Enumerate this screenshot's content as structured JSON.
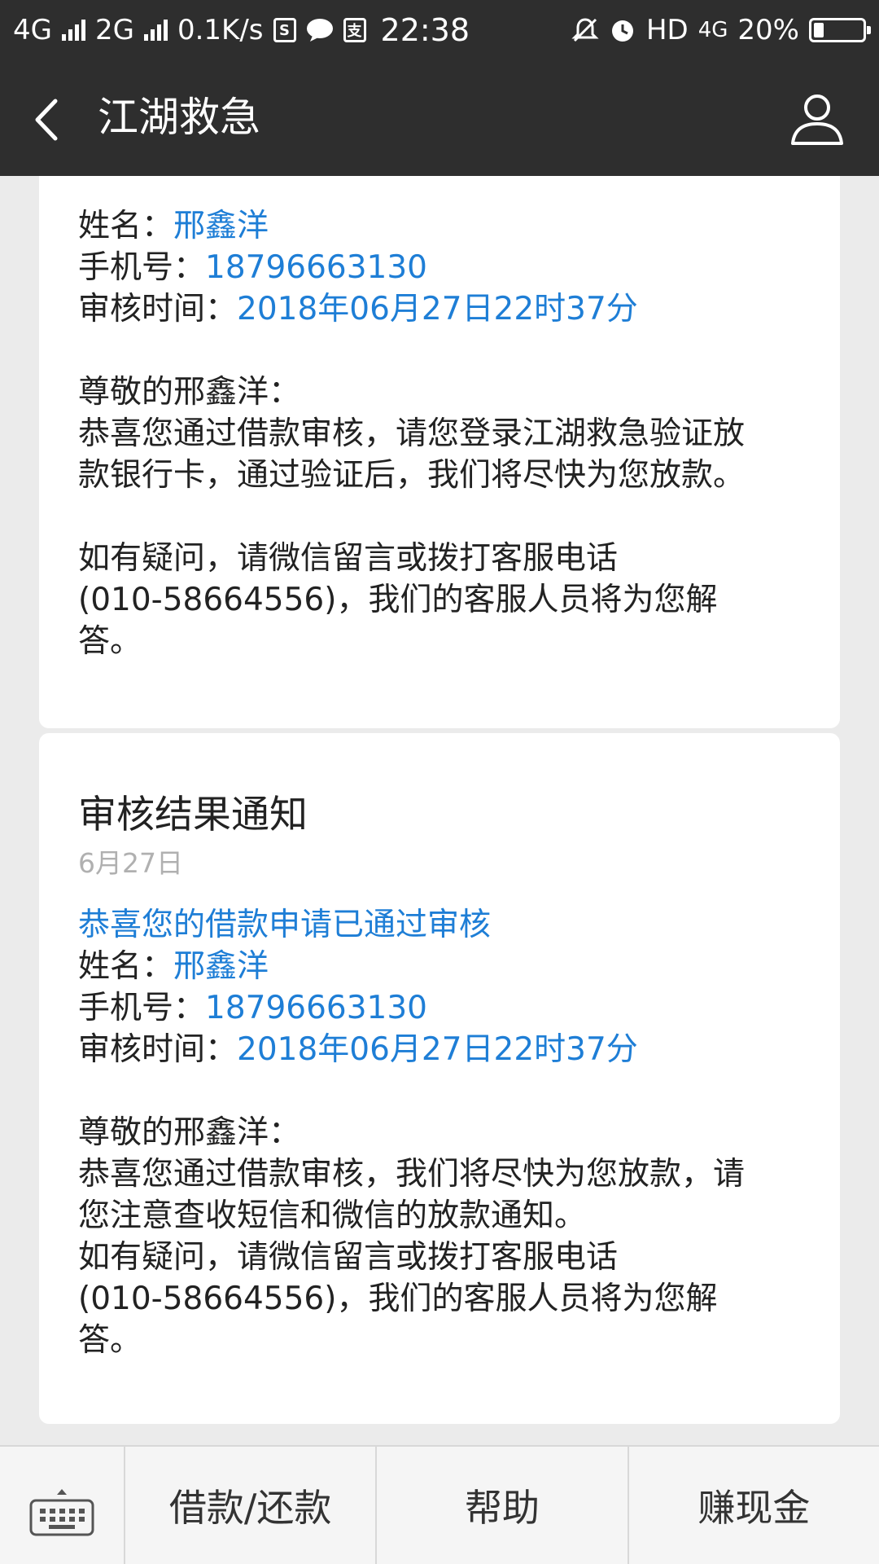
{
  "status_bar": {
    "net1": "4G",
    "net2": "2G",
    "speed": "0.1K/s",
    "time": "22:38",
    "hd": "HD",
    "net3": "4G",
    "battery": "20%",
    "battery_level": 0.2
  },
  "header": {
    "title": "江湖救急"
  },
  "card1": {
    "name_label": "姓名：",
    "name_value": "邢鑫洋",
    "phone_label": "手机号：",
    "phone_value": "18796663130",
    "time_label": "审核时间：",
    "time_value": "2018年06月27日22时37分",
    "greeting": "尊敬的邢鑫洋：",
    "body_line1": "恭喜您通过借款审核，请您登录江湖救急验证放",
    "body_line2": "款银行卡，通过验证后，我们将尽快为您放款。",
    "help_line1": "如有疑问，请微信留言或拨打客服电话",
    "help_line2": "(010-58664556)，我们的客服人员将为您解",
    "help_line3": "答。"
  },
  "card2": {
    "title": "审核结果通知",
    "date": "6月27日",
    "headline": "恭喜您的借款申请已通过审核",
    "name_label": "姓名：",
    "name_value": "邢鑫洋",
    "phone_label": "手机号：",
    "phone_value": "18796663130",
    "time_label": "审核时间：",
    "time_value": "2018年06月27日22时37分",
    "greeting": "尊敬的邢鑫洋：",
    "body_line1": "恭喜您通过借款审核，我们将尽快为您放款，请",
    "body_line2": "您注意查收短信和微信的放款通知。",
    "help_line1": "如有疑问，请微信留言或拨打客服电话",
    "help_line2": "(010-58664556)，我们的客服人员将为您解",
    "help_line3": "答。"
  },
  "bottom_nav": {
    "items": [
      {
        "label": "借款/还款"
      },
      {
        "label": "帮助"
      },
      {
        "label": "赚现金"
      }
    ]
  }
}
